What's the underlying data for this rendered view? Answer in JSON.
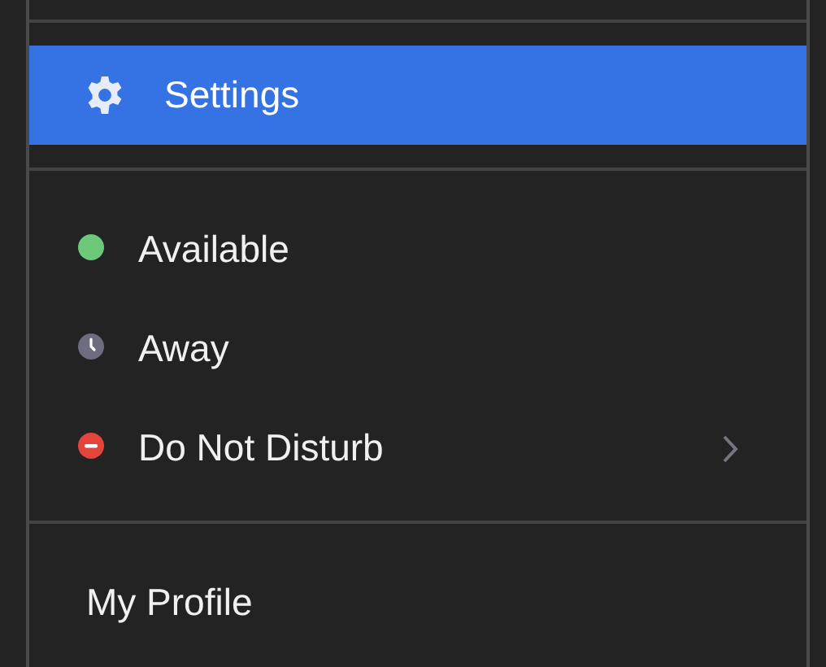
{
  "menu": {
    "sections": [
      {
        "items": [
          {
            "label": "Settings",
            "kind": "gear",
            "selected": true
          }
        ]
      },
      {
        "items": [
          {
            "label": "Available",
            "kind": "dot",
            "color": "#6cc97a",
            "selected": false
          },
          {
            "label": "Away",
            "kind": "clock",
            "color": "#6e6d80",
            "selected": false
          },
          {
            "label": "Do Not Disturb",
            "kind": "minus",
            "color": "#e5443d",
            "submenu": true,
            "selected": false
          }
        ]
      },
      {
        "items": [
          {
            "label": "My Profile",
            "kind": "plain",
            "selected": false
          }
        ]
      }
    ]
  }
}
